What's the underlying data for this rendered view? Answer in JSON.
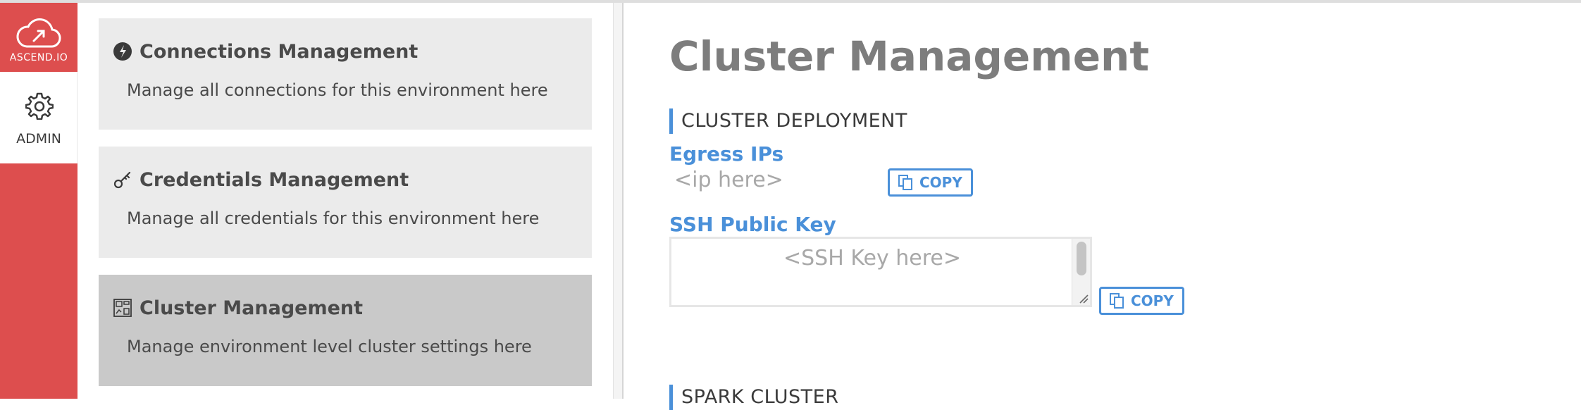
{
  "brand": {
    "name": "ASCEND.IO",
    "icon": "cloud-upload-icon",
    "color": "#dd4e4e"
  },
  "rail": {
    "admin_label": "ADMIN",
    "admin_icon": "gear-icon"
  },
  "cards": [
    {
      "title": "Connections Management",
      "description": "Manage all connections for this environment here",
      "icon": "connections-icon",
      "active": false
    },
    {
      "title": "Credentials Management",
      "description": "Manage all credentials for this environment here",
      "icon": "key-icon",
      "active": false
    },
    {
      "title": "Cluster Management",
      "description": "Manage environment level cluster settings here",
      "icon": "cluster-icon",
      "active": true
    }
  ],
  "main": {
    "title": "Cluster Management",
    "sections": [
      {
        "title": "CLUSTER DEPLOYMENT"
      },
      {
        "title": "SPARK CLUSTER"
      }
    ],
    "egress": {
      "label": "Egress IPs",
      "value": "<ip here>",
      "copy_label": "COPY"
    },
    "ssh": {
      "label": "SSH Public Key",
      "value": "<SSH Key here>",
      "copy_label": "COPY"
    }
  },
  "colors": {
    "accent": "#4a90d9",
    "active_card": "#c9c9c9",
    "card": "#ebebeb"
  }
}
